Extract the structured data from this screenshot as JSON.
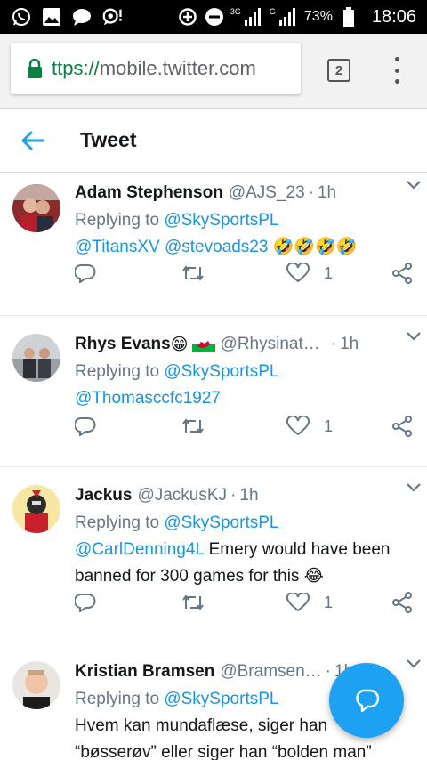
{
  "status_bar": {
    "network_3g": "3G",
    "network_g": "G",
    "battery": "73%",
    "time": "18:06"
  },
  "browser": {
    "url_scheme": "ttps://",
    "url_host": "mobile.twitter.com",
    "tab_count": "2"
  },
  "header": {
    "title": "Tweet"
  },
  "tweets": [
    {
      "name": "Adam Stephenson",
      "handle": "@AJS_23",
      "sep": "·",
      "time": "1h",
      "replying_prefix": "Replying to ",
      "replying_to": "@SkySportsPL",
      "mentions": "@TitansXV @stevoads23",
      "text": "",
      "emoji": "🤣🤣🤣🤣",
      "likes": "1"
    },
    {
      "name": "Rhys Evans",
      "name_emoji": "😁",
      "handle": "@Rhysinat…",
      "sep": "·",
      "time": "1h",
      "replying_prefix": "Replying to ",
      "replying_to": "@SkySportsPL",
      "mentions": "@Thomasccfc1927",
      "text": "",
      "likes": "1"
    },
    {
      "name": "Jackus",
      "handle": "@JackusKJ",
      "sep": "·",
      "time": "1h",
      "replying_prefix": "Replying to ",
      "replying_to": "@SkySportsPL",
      "mentions": "@CarlDenning4L",
      "text": " Emery would have been banned for 300 games for this ",
      "emoji": "😂",
      "likes": "1"
    },
    {
      "name": "Kristian Bramsen",
      "handle": "@Bramsen…",
      "sep": "·",
      "time": "1h",
      "replying_prefix": "Replying to ",
      "replying_to": "@SkySportsPL",
      "text": "Hvem kan mundaflæse, siger han",
      "text2": "“bøsserøv” eller siger han “bolden man”"
    }
  ],
  "icons": {
    "reply": "reply-icon",
    "retweet": "retweet-icon",
    "like": "heart-icon",
    "share": "share-icon",
    "compose": "compose-icon"
  },
  "colors": {
    "accent": "#1DA1F2",
    "link": "#1B95E0",
    "muted": "#657786",
    "secure": "#0B8043"
  }
}
